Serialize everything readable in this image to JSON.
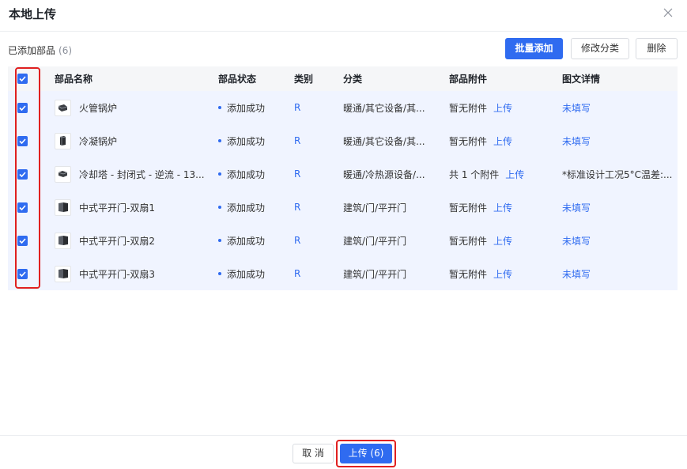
{
  "dialog": {
    "title": "本地上传"
  },
  "toolbar": {
    "added_label": "已添加部品",
    "added_count": "(6)",
    "batch_add": "批量添加",
    "edit_category": "修改分类",
    "delete": "删除"
  },
  "table": {
    "headers": {
      "name": "部品名称",
      "state": "部品状态",
      "category": "类别",
      "classification": "分类",
      "attachments": "部品附件",
      "details": "图文详情"
    },
    "rows": [
      {
        "name": "火管锅炉",
        "icon": "boiler-icon",
        "state": "添加成功",
        "category": "R",
        "classification": "暖通/其它设备/其...",
        "attachment_text": "暂无附件",
        "upload_link": "上传",
        "detail": "未填写",
        "detail_is_link": true,
        "checked": true
      },
      {
        "name": "冷凝锅炉",
        "icon": "condensing-boiler-icon",
        "state": "添加成功",
        "category": "R",
        "classification": "暖通/其它设备/其...",
        "attachment_text": "暂无附件",
        "upload_link": "上传",
        "detail": "未填写",
        "detail_is_link": true,
        "checked": true
      },
      {
        "name": "冷却塔 - 封闭式 - 逆流 - 13...",
        "icon": "cooling-tower-icon",
        "state": "添加成功",
        "category": "R",
        "classification": "暖通/冷热源设备/...",
        "attachment_text": "共 1 个附件",
        "upload_link": "上传",
        "detail": "*标准设计工况5°C温差:...",
        "detail_is_link": false,
        "checked": true
      },
      {
        "name": "中式平开门-双扇1",
        "icon": "double-door-icon",
        "state": "添加成功",
        "category": "R",
        "classification": "建筑/门/平开门",
        "attachment_text": "暂无附件",
        "upload_link": "上传",
        "detail": "未填写",
        "detail_is_link": true,
        "checked": true
      },
      {
        "name": "中式平开门-双扇2",
        "icon": "double-door-icon",
        "state": "添加成功",
        "category": "R",
        "classification": "建筑/门/平开门",
        "attachment_text": "暂无附件",
        "upload_link": "上传",
        "detail": "未填写",
        "detail_is_link": true,
        "checked": true
      },
      {
        "name": "中式平开门-双扇3",
        "icon": "double-door-icon",
        "state": "添加成功",
        "category": "R",
        "classification": "建筑/门/平开门",
        "attachment_text": "暂无附件",
        "upload_link": "上传",
        "detail": "未填写",
        "detail_is_link": true,
        "checked": true
      }
    ]
  },
  "footer": {
    "cancel": "取 消",
    "upload": "上传 (6)"
  },
  "colors": {
    "primary": "#2f6bf0",
    "highlight": "#e02020",
    "row_bg": "#f0f4ff"
  }
}
